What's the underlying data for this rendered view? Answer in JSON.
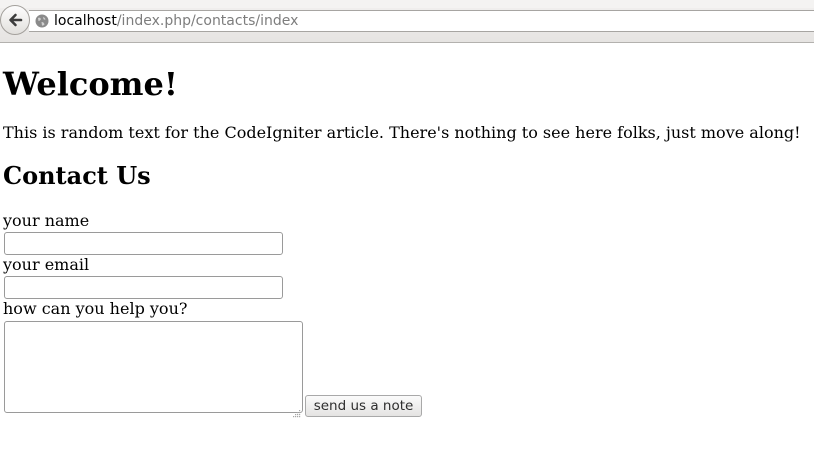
{
  "browser": {
    "url_host": "localhost",
    "url_path": "/index.php/contacts/index"
  },
  "page": {
    "heading": "Welcome!",
    "intro": "This is random text for the CodeIgniter article. There's nothing to see here folks, just move along!",
    "contact_heading": "Contact Us"
  },
  "form": {
    "name_label": "your name",
    "name_value": "",
    "email_label": "your email",
    "email_value": "",
    "message_label": "how can you help you?",
    "message_value": "",
    "submit_label": "send us a note"
  },
  "icons": {
    "back": "back-arrow-icon",
    "site": "globe-icon",
    "resize": "resize-grip-icon"
  }
}
